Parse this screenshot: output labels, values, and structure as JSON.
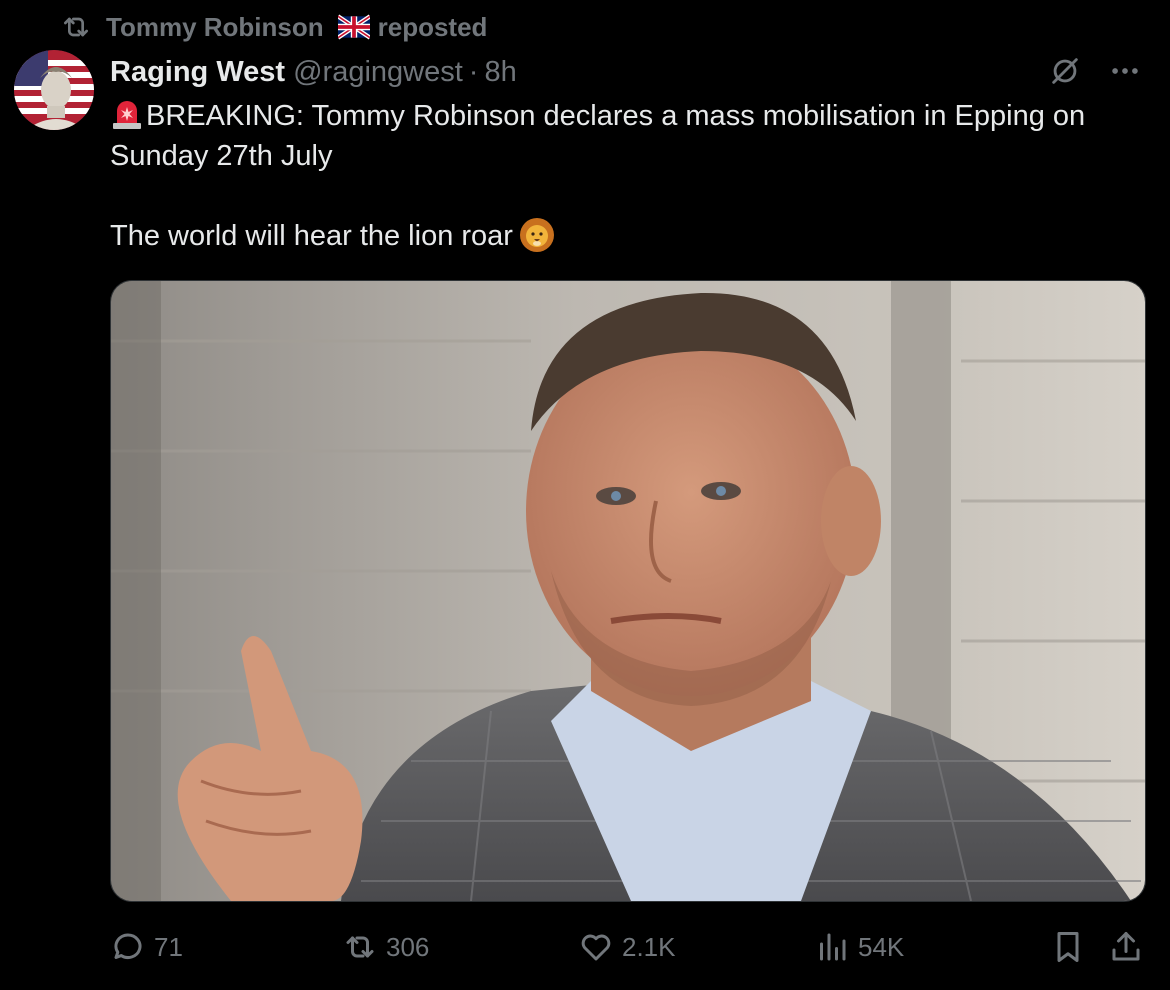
{
  "repost": {
    "reposter": "Tommy Robinson",
    "label": "reposted"
  },
  "tweet": {
    "display_name": "Raging West",
    "handle": "@ragingwest",
    "separator": "·",
    "time": "8h",
    "text_line1": "BREAKING: Tommy Robinson declares a mass mobilisation in Epping on Sunday 27th July",
    "text_line2": "The world will hear the lion roar"
  },
  "actions": {
    "replies": "71",
    "reposts": "306",
    "likes": "2.1K",
    "views": "54K"
  },
  "icons": {
    "repost": "repost-icon",
    "flag": "uk-flag-icon",
    "grok": "grok-icon",
    "more": "more-icon",
    "siren": "siren-emoji",
    "lion": "lion-emoji",
    "reply": "reply-icon",
    "like": "heart-icon",
    "views": "views-icon",
    "bookmark": "bookmark-icon",
    "share": "share-icon"
  },
  "colors": {
    "background": "#000000",
    "text": "#e7e9ea",
    "muted": "#71767b"
  }
}
